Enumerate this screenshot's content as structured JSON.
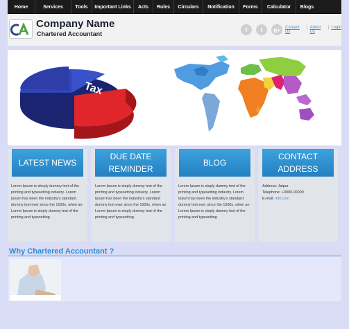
{
  "nav": {
    "items": [
      {
        "label": "Home"
      },
      {
        "label": "Services"
      },
      {
        "label": "Tools"
      },
      {
        "label": "Important Links"
      },
      {
        "label": "Acts"
      },
      {
        "label": "Rules"
      },
      {
        "label": "Circulars"
      },
      {
        "label": "Notification"
      },
      {
        "label": "Forms"
      },
      {
        "label": "Calculator"
      },
      {
        "label": "Blogs"
      }
    ]
  },
  "header": {
    "logo_text": "CA",
    "company_name": "Company Name",
    "company_sub": "Chartered Accountant",
    "social": {
      "facebook": "f",
      "twitter": "t",
      "googleplus": "g+"
    },
    "links": {
      "contact": "Contact Us",
      "about": "About Us",
      "login": "Login"
    },
    "sep": "|"
  },
  "banner": {
    "pie_label": "Tax",
    "colors": {
      "pie_blue": "#2d3ea8",
      "pie_red": "#e0262b"
    }
  },
  "boxes": {
    "news": {
      "title": "LATEST NEWS",
      "text": "Lorem Ipsum is siteply dummy text of the printing and typesetting industry. Lorem Ipsum has been the industry's standard dummy text ever since the 1500s, when an Lorem Ipsum is steply dummy text of the printing and typesetting"
    },
    "due": {
      "title_line1": "DUE DATE",
      "title_line2": "REMINDER",
      "text": "Lorem Ipsum is steply dummy text of the printing and typesetting industry. Lorem Ipsum has been the industry's standard dummy text ever since the 1500s, when an Lorem Ipsum is steply dummy text of the printing and typesetting"
    },
    "blog": {
      "title": "BLOG",
      "text": "Lorem Ipsum is steply dummy text of the printing and typesetting industry. Lorem Ipsum has been the industry's standard dummy text ever since the 1500s, when an Lorem Ipsum is steply dummy text of the printing and typesetting"
    },
    "contact": {
      "title_line1": "CONTACT",
      "title_line2": "ADDRESS",
      "address": "Address: Jaipur",
      "telephone": "Telephone: +0000-00000",
      "email_label": "E-mail: ",
      "email_value": "Info.com"
    }
  },
  "why": {
    "title": "Why Chartered Accountant ?"
  },
  "colors": {
    "accent": "#2e8cd1",
    "nav_bg": "#1b1b1b",
    "ribbon": "#2a8acd"
  }
}
